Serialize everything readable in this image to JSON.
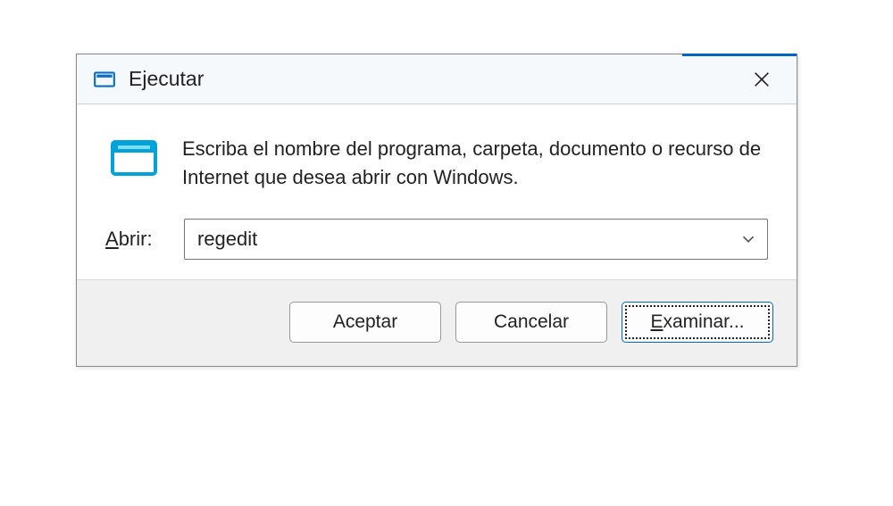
{
  "titlebar": {
    "title": "Ejecutar"
  },
  "body": {
    "instruction": "Escriba el nombre del programa, carpeta, documento o recurso de Internet que desea abrir con Windows.",
    "open_label_pre": "A",
    "open_label_rest": "brir:",
    "input_value": "regedit"
  },
  "footer": {
    "accept_label": "Aceptar",
    "cancel_label": "Cancelar",
    "browse_pre": "E",
    "browse_rest": "xaminar..."
  }
}
